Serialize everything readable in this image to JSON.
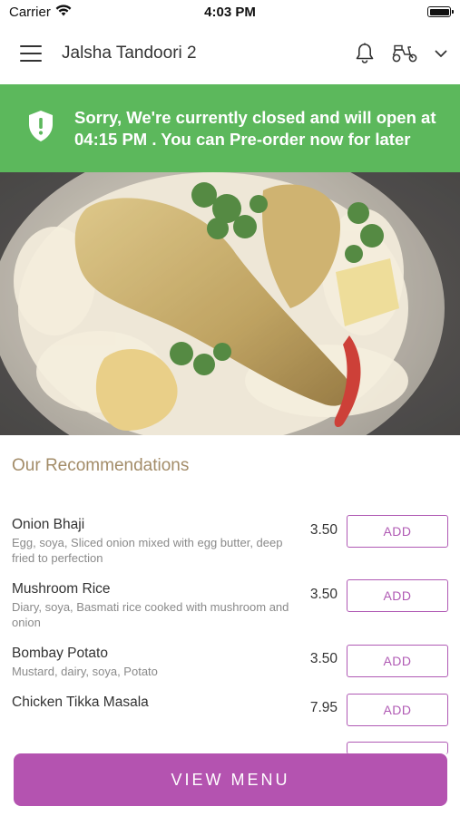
{
  "status_bar": {
    "carrier": "Carrier",
    "time": "4:03 PM"
  },
  "header": {
    "title": "Jalsha Tandoori 2",
    "icons": [
      "menu-icon",
      "bell-icon",
      "scooter-icon",
      "chevron-down-icon"
    ]
  },
  "banner": {
    "text": "Sorry, We're currently closed and will open at 04:15 PM . You can Pre-order now for later",
    "color": "#5cb85c",
    "icon": "shield-alert-icon"
  },
  "hero": {
    "image": "chicken-biryani-photo"
  },
  "recommendations": {
    "title": "Our Recommendations",
    "items": [
      {
        "name": "Onion Bhaji",
        "description": "Egg, soya, Sliced onion mixed with egg butter, deep fried to perfection",
        "price": "3.50",
        "action": "ADD"
      },
      {
        "name": "Mushroom Rice",
        "description": "Diary, soya, Basmati rice cooked with mushroom and onion",
        "price": "3.50",
        "action": "ADD"
      },
      {
        "name": "Bombay Potato",
        "description": "Mustard, dairy, soya, Potato",
        "price": "3.50",
        "action": "ADD"
      },
      {
        "name": "Chicken Tikka Masala",
        "description": "",
        "price": "7.95",
        "action": "ADD"
      }
    ]
  },
  "footer": {
    "view_menu_label": "VIEW MENU",
    "accent": "#b453b0"
  }
}
